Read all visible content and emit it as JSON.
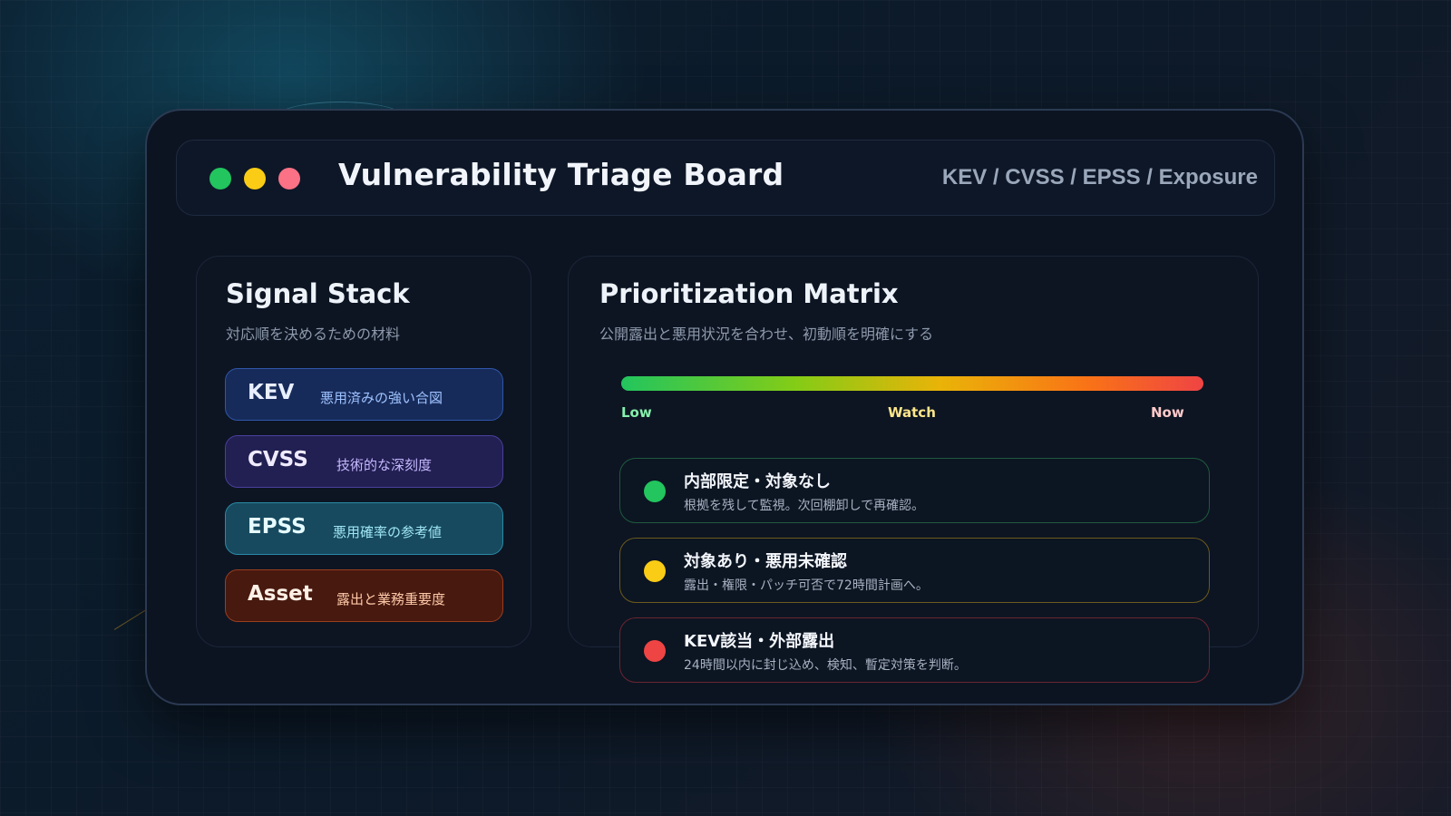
{
  "window": {
    "title": "Vulnerability Triage Board",
    "subtitle": "KEV / CVSS / EPSS / Exposure"
  },
  "signal_stack": {
    "title": "Signal Stack",
    "subtitle": "対応順を決めるための材料",
    "items": [
      {
        "name": "KEV",
        "description": "悪用済みの強い合図"
      },
      {
        "name": "CVSS",
        "description": "技術的な深刻度"
      },
      {
        "name": "EPSS",
        "description": "悪用確率の参考値"
      },
      {
        "name": "Asset",
        "description": "露出と業務重要度"
      }
    ]
  },
  "matrix": {
    "title": "Prioritization Matrix",
    "subtitle": "公開露出と悪用状況を合わせ、初動順を明確にする",
    "scale": {
      "low": "Low",
      "watch": "Watch",
      "now": "Now"
    },
    "tiers": [
      {
        "title": "内部限定・対象なし",
        "description": "根拠を残して監視。次回棚卸しで再確認。",
        "color": "#22c55e"
      },
      {
        "title": "対象あり・悪用未確認",
        "description": "露出・権限・パッチ可否で72時間計画へ。",
        "color": "#facc15"
      },
      {
        "title": "KEV該当・外部露出",
        "description": "24時間以内に封じ込め、検知、暫定対策を判断。",
        "color": "#ef4444"
      }
    ]
  },
  "colors": {
    "low": "#22c55e",
    "watch": "#eab308",
    "now": "#ef4444"
  }
}
